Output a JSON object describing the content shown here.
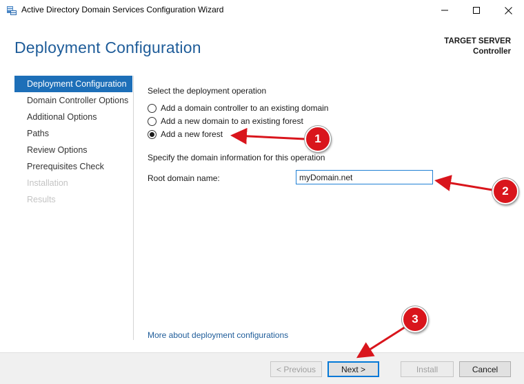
{
  "window": {
    "title": "Active Directory Domain Services Configuration Wizard",
    "icon": "ad-ds-wizard-icon",
    "controls": [
      "minimize-icon",
      "maximize-icon",
      "close-icon"
    ]
  },
  "header": {
    "page_title": "Deployment Configuration",
    "target_label": "TARGET SERVER",
    "target_name": "Controller"
  },
  "nav": {
    "items": [
      {
        "label": "Deployment Configuration",
        "state": "active"
      },
      {
        "label": "Domain Controller Options",
        "state": "normal"
      },
      {
        "label": "Additional Options",
        "state": "normal"
      },
      {
        "label": "Paths",
        "state": "normal"
      },
      {
        "label": "Review Options",
        "state": "normal"
      },
      {
        "label": "Prerequisites Check",
        "state": "normal"
      },
      {
        "label": "Installation",
        "state": "disabled"
      },
      {
        "label": "Results",
        "state": "disabled"
      }
    ]
  },
  "main": {
    "operation_heading": "Select the deployment operation",
    "options": [
      {
        "label": "Add a domain controller to an existing domain",
        "selected": false
      },
      {
        "label": "Add a new domain to an existing forest",
        "selected": false
      },
      {
        "label": "Add a new forest",
        "selected": true
      }
    ],
    "domain_heading": "Specify the domain information for this operation",
    "root_domain_label": "Root domain name:",
    "root_domain_value": "myDomain.net",
    "more_link": "More about deployment configurations"
  },
  "footer": {
    "previous_label": "< Previous",
    "next_label": "Next >",
    "install_label": "Install",
    "cancel_label": "Cancel"
  },
  "annotations": {
    "markers": [
      "1",
      "2",
      "3"
    ],
    "color": "#d9151c"
  }
}
